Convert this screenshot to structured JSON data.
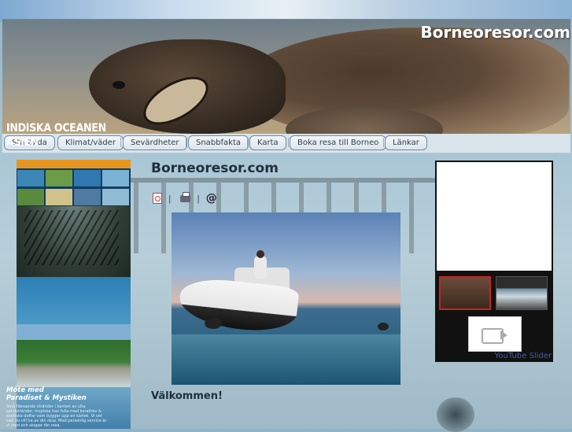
{
  "site": {
    "title": "Borneoresor.com"
  },
  "nav": {
    "items": [
      {
        "label": "Startsida"
      },
      {
        "label": "Klimat/väder"
      },
      {
        "label": "Sevärdheter"
      },
      {
        "label": "Snabbfakta"
      },
      {
        "label": "Karta"
      },
      {
        "label": "Boka resa till Borneo"
      },
      {
        "label": "Länkar"
      }
    ]
  },
  "ad": {
    "title_line1": "INDISKA OCEANEN",
    "title_line2": "ASIEN",
    "subtitle_line1": "Möte med",
    "subtitle_line2": "Paradiset & Mystiken",
    "small_text": "Små flänsande stränder i kanten av vita sandstränder, tropiska hav fulla med korallrev & exotiska dofter som bygger upp en kärlek. Vi vet vad du vill ha av din resa. Med personlig service är vi med och skapar din resa."
  },
  "main": {
    "title": "Borneoresor.com",
    "tools": {
      "pdf": "pdf-icon",
      "print": "print-icon",
      "email": "@"
    },
    "tool_separator": "|",
    "welcome": "Välkommen!"
  },
  "slider": {
    "label": "YouTube Slider"
  },
  "colors": {
    "nav_border": "#6d8aa3",
    "thumb_active": "#cc2222",
    "link": "#4a5ea8"
  }
}
